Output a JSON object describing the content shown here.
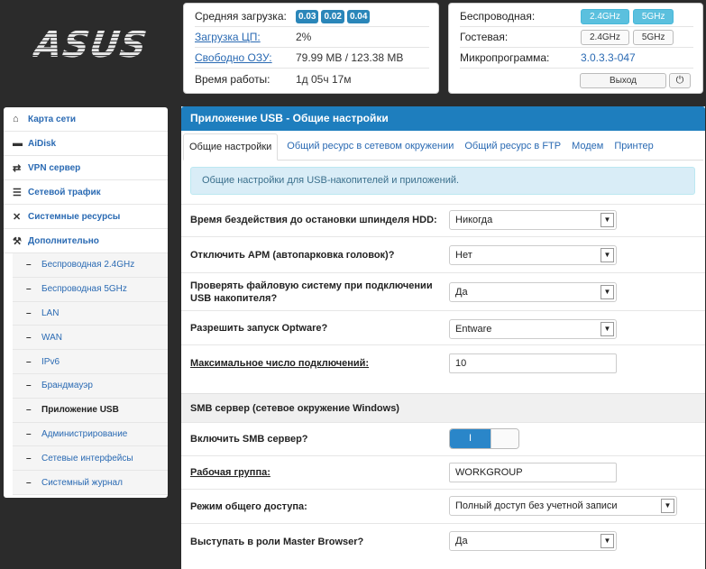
{
  "logo": "ASUS",
  "status": {
    "load_label": "Средняя загрузка:",
    "load_values": [
      "0.03",
      "0.02",
      "0.04"
    ],
    "cpu_label": "Загрузка ЦП:",
    "cpu_value": "2%",
    "ram_label": "Свободно ОЗУ:",
    "ram_value": "79.99 MB / 123.38 MB",
    "uptime_label": "Время работы:",
    "uptime_value": "1д 05ч 17м"
  },
  "firmware": {
    "wireless_label": "Беспроводная:",
    "wireless_24": "2.4GHz",
    "wireless_5": "5GHz",
    "guest_label": "Гостевая:",
    "guest_24": "2.4GHz",
    "guest_5": "5GHz",
    "fw_label": "Микропрограмма:",
    "fw_value": "3.0.3.3-047",
    "logout": "Выход"
  },
  "sidebar": {
    "items": [
      {
        "label": "Карта сети",
        "icon": "home-icon"
      },
      {
        "label": "AiDisk",
        "icon": "disk-icon"
      },
      {
        "label": "VPN сервер",
        "icon": "vpn-icon"
      },
      {
        "label": "Сетевой трафик",
        "icon": "traffic-icon"
      },
      {
        "label": "Системные ресурсы",
        "icon": "shuffle-icon"
      },
      {
        "label": "Дополнительно",
        "icon": "wrench-icon"
      }
    ],
    "sub_items": [
      "Беспроводная 2.4GHz",
      "Беспроводная 5GHz",
      "LAN",
      "WAN",
      "IPv6",
      "Брандмауэр",
      "Приложение USB",
      "Администрирование",
      "Сетевые интерфейсы",
      "Системный журнал"
    ]
  },
  "main": {
    "title": "Приложение USB - Общие настройки",
    "tabs": [
      "Общие настройки",
      "Общий ресурс в сетевом окружении",
      "Общий ресурс в FTP",
      "Модем",
      "Принтер"
    ],
    "info": "Общие настройки для USB-накопителей и приложений.",
    "fields": {
      "hdd_label": "Время бездействия до остановки шпинделя HDD:",
      "hdd_value": "Никогда",
      "apm_label": "Отключить APM (автопарковка головок)?",
      "apm_value": "Нет",
      "fscheck_label": "Проверять файловую систему при подключении USB накопителя?",
      "fscheck_value": "Да",
      "optware_label": "Разрешить запуск Optware?",
      "optware_value": "Entware",
      "maxconn_label": "Максимальное число подключений:",
      "maxconn_value": "10"
    },
    "smb": {
      "section": "SMB сервер (сетевое окружение Windows)",
      "enable_label": "Включить SMB сервер?",
      "toggle_on": "I",
      "workgroup_label": "Рабочая группа:",
      "workgroup_value": "WORKGROUP",
      "access_label": "Режим общего доступа:",
      "access_value": "Полный доступ без учетной записи",
      "master_label": "Выступать в роли Master Browser?",
      "master_value": "Да"
    }
  }
}
